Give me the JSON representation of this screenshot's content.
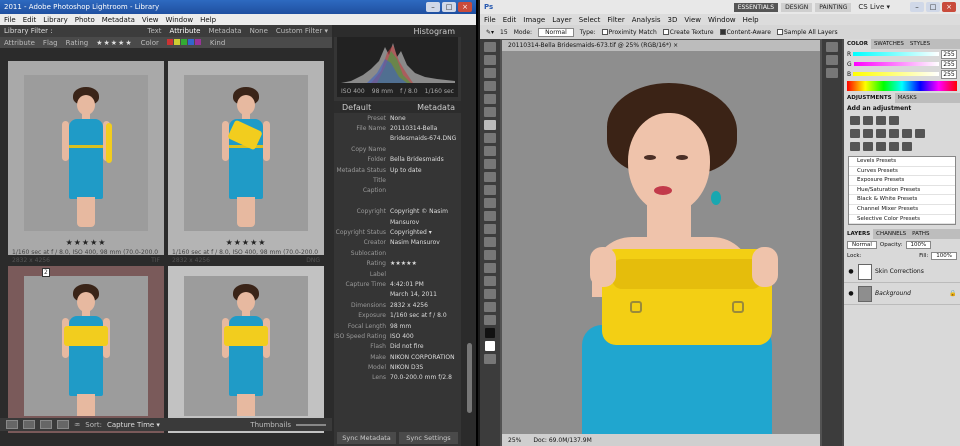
{
  "lightroom": {
    "title": "2011 - Adobe Photoshop Lightroom - Library",
    "menu": [
      "File",
      "Edit",
      "Library",
      "Photo",
      "Metadata",
      "View",
      "Window",
      "Help"
    ],
    "filter": {
      "label": "Library Filter :",
      "options": [
        "Text",
        "Attribute",
        "Metadata",
        "None"
      ],
      "preset": "Custom Filter ▾"
    },
    "attribute_bar": {
      "label": "Attribute",
      "flag": "Flag",
      "rating": "Rating",
      "rating_stars": "★★★★★",
      "color": "Color",
      "kind": "Kind"
    },
    "thumbnails": [
      {
        "stars": "★★★★★",
        "meta": "1/160 sec at f / 8.0, ISO 400, 98 mm (70.0-200.0 mm f/2.8)",
        "dims": "2832 x 4256",
        "ext": "TIF",
        "index": ""
      },
      {
        "stars": "★★★★★",
        "meta": "1/160 sec at f / 8.0, ISO 400, 98 mm (70.0-200.0 mm f/2.8)",
        "dims": "2832 x 4256",
        "ext": "DNG",
        "index": ""
      },
      {
        "stars": "★★★★★",
        "meta": "",
        "dims": "",
        "ext": "",
        "index": "2"
      },
      {
        "stars": "★★★★★",
        "meta": "",
        "dims": "",
        "ext": "",
        "index": ""
      }
    ],
    "toolbar": {
      "sort_label": "Sort:",
      "sort_value": "Capture Time ▾",
      "thumbnails_label": "Thumbnails"
    },
    "histogram": {
      "title": "Histogram",
      "iso": "ISO 400",
      "focal": "98 mm",
      "aperture": "f / 8.0",
      "shutter": "1/160 sec"
    },
    "metadata": {
      "title": "Metadata",
      "preset_select": "Default",
      "rows": [
        {
          "k": "Preset",
          "v": "None"
        },
        {
          "k": "File Name",
          "v": "20110314-Bella"
        },
        {
          "k": "",
          "v": "Bridesmaids-674.DNG"
        },
        {
          "k": "Copy Name",
          "v": ""
        },
        {
          "k": "Folder",
          "v": "Bella Bridesmaids"
        },
        {
          "k": "Metadata Status",
          "v": "Up to date"
        },
        {
          "k": "Title",
          "v": ""
        },
        {
          "k": "Caption",
          "v": ""
        },
        {
          "k": "",
          "v": ""
        },
        {
          "k": "Copyright",
          "v": "Copyright © Nasim"
        },
        {
          "k": "",
          "v": "Mansurov"
        },
        {
          "k": "Copyright Status",
          "v": "Copyrighted ▾"
        },
        {
          "k": "Creator",
          "v": "Nasim Mansurov"
        },
        {
          "k": "Sublocation",
          "v": ""
        },
        {
          "k": "Rating",
          "v": "★★★★★"
        },
        {
          "k": "Label",
          "v": ""
        },
        {
          "k": "Capture Time",
          "v": "4:42:01 PM"
        },
        {
          "k": "",
          "v": "March 14, 2011"
        },
        {
          "k": "Dimensions",
          "v": "2832 x 4256"
        },
        {
          "k": "Exposure",
          "v": "1/160 sec at f / 8.0"
        },
        {
          "k": "Focal Length",
          "v": "98 mm"
        },
        {
          "k": "ISO Speed Rating",
          "v": "ISO 400"
        },
        {
          "k": "Flash",
          "v": "Did not fire"
        },
        {
          "k": "Make",
          "v": "NIKON CORPORATION"
        },
        {
          "k": "Model",
          "v": "NIKON D3S"
        },
        {
          "k": "Lens",
          "v": "70.0-200.0 mm f/2.8"
        }
      ]
    },
    "buttons": {
      "sync_metadata": "Sync Metadata",
      "sync_settings": "Sync Settings"
    }
  },
  "photoshop": {
    "title": "Ps",
    "menu": [
      "File",
      "Edit",
      "Image",
      "Layer",
      "Select",
      "Filter",
      "Analysis",
      "3D",
      "View",
      "Window",
      "Help"
    ],
    "workspaces": [
      "ESSENTIALS",
      "DESIGN",
      "PAINTING"
    ],
    "cslive": "CS Live ▾",
    "options": {
      "mode_label": "Mode:",
      "mode_value": "Normal",
      "type_label": "Type:",
      "proximity": "Proximity Match",
      "texture": "Create Texture",
      "content_aware": "Content-Aware",
      "sample_all": "Sample All Layers",
      "brush_size": "15"
    },
    "doc_tab": "20110314-Bella Bridesmaids-673.tif @ 25% (RGB/16*) ×",
    "status": {
      "zoom": "25%",
      "doc": "Doc: 69.0M/137.9M"
    },
    "color_panel": {
      "tabs": [
        "COLOR",
        "SWATCHES",
        "STYLES"
      ],
      "r": "255",
      "g": "255",
      "b": "255",
      "r_label": "R",
      "g_label": "G",
      "b_label": "B"
    },
    "adjustments": {
      "tabs": [
        "ADJUSTMENTS",
        "MASKS"
      ],
      "title": "Add an adjustment",
      "presets": [
        "Levels Presets",
        "Curves Presets",
        "Exposure Presets",
        "Hue/Saturation Presets",
        "Black & White Presets",
        "Channel Mixer Presets",
        "Selective Color Presets"
      ]
    },
    "layers": {
      "tabs": [
        "LAYERS",
        "CHANNELS",
        "PATHS"
      ],
      "blend": "Normal",
      "opacity_label": "Opacity:",
      "opacity": "100%",
      "fill_label": "Fill:",
      "fill": "100%",
      "lock_label": "Lock:",
      "items": [
        {
          "name": "Skin Corrections",
          "adj": true
        },
        {
          "name": "Background",
          "adj": false
        }
      ]
    }
  }
}
